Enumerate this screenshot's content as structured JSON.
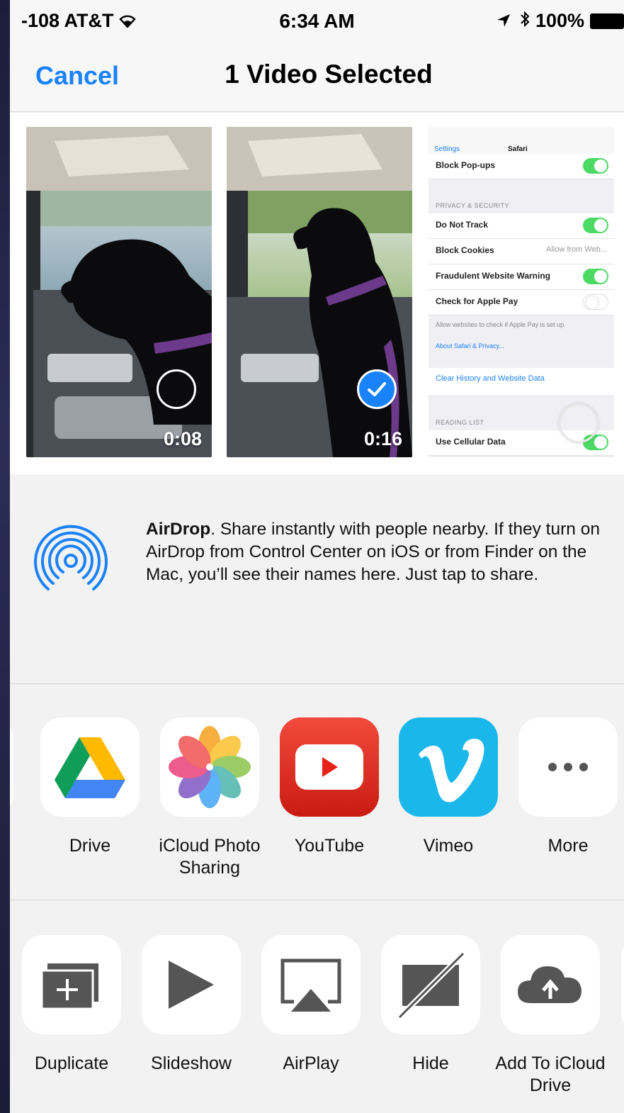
{
  "status_bar": {
    "carrier": "-108 AT&T",
    "time": "6:34 AM",
    "battery": "100%"
  },
  "nav": {
    "cancel_label": "Cancel",
    "title": "1 Video Selected"
  },
  "photos": [
    {
      "duration": "0:08",
      "selected": false
    },
    {
      "duration": "0:16",
      "selected": true
    }
  ],
  "settings_thumb": {
    "back": "Settings",
    "title": "Safari",
    "rows": {
      "block_popups": "Block Pop-ups",
      "privacy_header": "PRIVACY & SECURITY",
      "dnt": "Do Not Track",
      "block_cookies": "Block Cookies",
      "block_cookies_value": "Allow from Web...",
      "fraud": "Fraudulent Website Warning",
      "apple_pay": "Check for Apple Pay",
      "apple_pay_note": "Allow websites to check if Apple Pay is set up.",
      "about_link": "About Safari & Privacy...",
      "clear": "Clear History and Website Data",
      "reading_header": "READING LIST",
      "cellular": "Use Cellular Data"
    }
  },
  "airdrop": {
    "title": "AirDrop",
    "body": ". Share instantly with people nearby. If they turn on AirDrop from Control Center on iOS or from Finder on the Mac, you’ll see their names here. Just tap to share."
  },
  "share_apps": [
    {
      "label": "Drive",
      "icon": "google-drive-icon"
    },
    {
      "label": "iCloud Photo Sharing",
      "icon": "photos-icon"
    },
    {
      "label": "YouTube",
      "icon": "youtube-icon"
    },
    {
      "label": "Vimeo",
      "icon": "vimeo-icon"
    },
    {
      "label": "More",
      "icon": "more-icon"
    }
  ],
  "actions": [
    {
      "label": "Duplicate",
      "icon": "duplicate-icon"
    },
    {
      "label": "Slideshow",
      "icon": "play-icon"
    },
    {
      "label": "AirPlay",
      "icon": "airplay-icon"
    },
    {
      "label": "Hide",
      "icon": "hide-icon"
    },
    {
      "label": "Add To iCloud Drive",
      "icon": "cloud-upload-icon"
    }
  ],
  "colors": {
    "accent": "#1a82fb",
    "toggle_on": "#4cd964",
    "youtube_red": "#e62117",
    "vimeo_blue": "#1ab7ea"
  }
}
